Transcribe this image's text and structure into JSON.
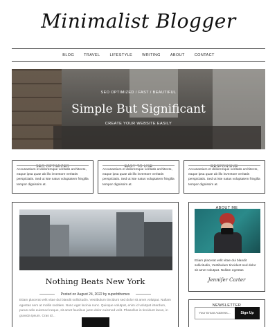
{
  "site": {
    "logo": "Minimalist Blogger"
  },
  "nav": {
    "items": [
      "BLOG",
      "TRAVEL",
      "LIFESTYLE",
      "WRITING",
      "ABOUT",
      "CONTACT"
    ]
  },
  "hero": {
    "kicker": "SEO OPTIMIZED / FAST / BEAUTIFUL",
    "title": "Simple But Significant",
    "subtitle": "CREATE YOUR WEBSITE EASILY"
  },
  "features": [
    {
      "title": "SEO OPTIMIZED",
      "text": "Accusantium et doloremque veritatis architecto, eaque ipsa quae ab illo inventore veritatis perspiciatis. Sed ut iste natus voluptatem fringilla tempor dignissim at."
    },
    {
      "title": "EASY TO USE",
      "text": "Accusantium et doloremque veritatis architecto, eaque ipsa quae ab illo inventore veritatis perspiciatis. Sed ut iste natus voluptatem fringilla tempor dignissim at."
    },
    {
      "title": "RESPONSIVE",
      "text": "Accusantium et doloremque veritatis architecto, eaque ipsa quae ab illo inventore veritatis perspiciatis. Sed ut iste natus voluptatem fringilla tempor dignissim at."
    }
  ],
  "post": {
    "title": "Nothing Beats New York",
    "meta": "Posted on August 24, 2022 by superbthemes",
    "excerpt": "Etiam placerat velit vitae dui blandit sollicitudin. Vestibulum tincidunt sed dolor sit amet volutpat. Nullam egestas sem at mollis sodales. Nunc eget lacinia nunc. Quisque volutpat, enim id volutpat interdum, purus odio euismod neque, sit amet faucibus justo dolor euismod velit. Phasellus in tincidunt lacus, in gravida ipsum. Cras id..."
  },
  "about": {
    "title": "ABOUT ME",
    "text": "Etiam placerat velit vitae dui blandit sollicitudin, Vestibulum tincidunt sed dolor sit amet volutpat. Nullam egestas",
    "signature": "Jennifer Carter"
  },
  "newsletter": {
    "title": "NEWSLETTER",
    "email_placeholder": "Your Email Address...",
    "button": "Sign Up"
  }
}
